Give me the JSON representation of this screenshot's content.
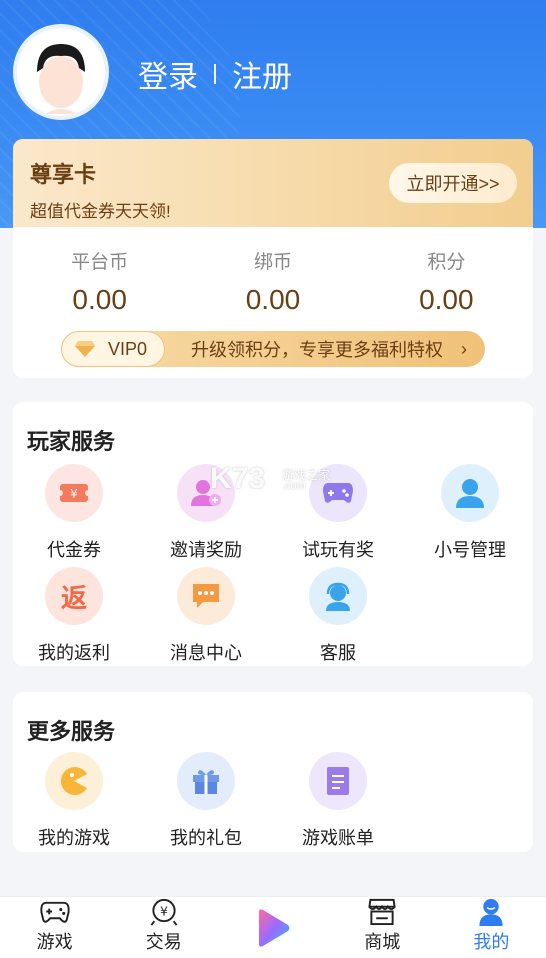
{
  "header": {
    "login": "登录",
    "register": "注册"
  },
  "vip_card": {
    "title": "尊享卡",
    "subtitle": "超值代金券天天领!",
    "button": "立即开通>>",
    "stats": [
      {
        "label": "平台币",
        "value": "0.00"
      },
      {
        "label": "绑币",
        "value": "0.00"
      },
      {
        "label": "积分",
        "value": "0.00"
      }
    ],
    "vip_level": "VIP0",
    "vip_bar_text": "升级领积分，专享更多福利特权",
    "vip_bar_arrow": "›"
  },
  "player_services": {
    "title": "玩家服务",
    "items": [
      {
        "label": "代金券",
        "icon": "voucher-icon"
      },
      {
        "label": "邀请奖励",
        "icon": "invite-icon"
      },
      {
        "label": "试玩有奖",
        "icon": "gamepad-icon"
      },
      {
        "label": "小号管理",
        "icon": "user-icon"
      },
      {
        "label": "我的返利",
        "icon": "rebate-icon",
        "glyph": "返"
      },
      {
        "label": "消息中心",
        "icon": "message-icon"
      },
      {
        "label": "客服",
        "icon": "support-icon"
      }
    ]
  },
  "more_services": {
    "title": "更多服务",
    "items": [
      {
        "label": "我的游戏",
        "icon": "game-icon"
      },
      {
        "label": "我的礼包",
        "icon": "gift-icon"
      },
      {
        "label": "游戏账单",
        "icon": "bill-icon"
      }
    ]
  },
  "watermark": {
    "brand": "K73",
    "site": "游戏之家",
    "domain": ".com"
  },
  "tabbar": [
    {
      "label": "游戏",
      "icon": "gamepad-tab-icon"
    },
    {
      "label": "交易",
      "icon": "trade-icon"
    },
    {
      "label": "",
      "icon": "play-icon"
    },
    {
      "label": "商城",
      "icon": "store-icon"
    },
    {
      "label": "我的",
      "icon": "profile-icon",
      "active": true
    }
  ],
  "colors": {
    "primary": "#2f7df0",
    "gold_text": "#6b3f14"
  }
}
